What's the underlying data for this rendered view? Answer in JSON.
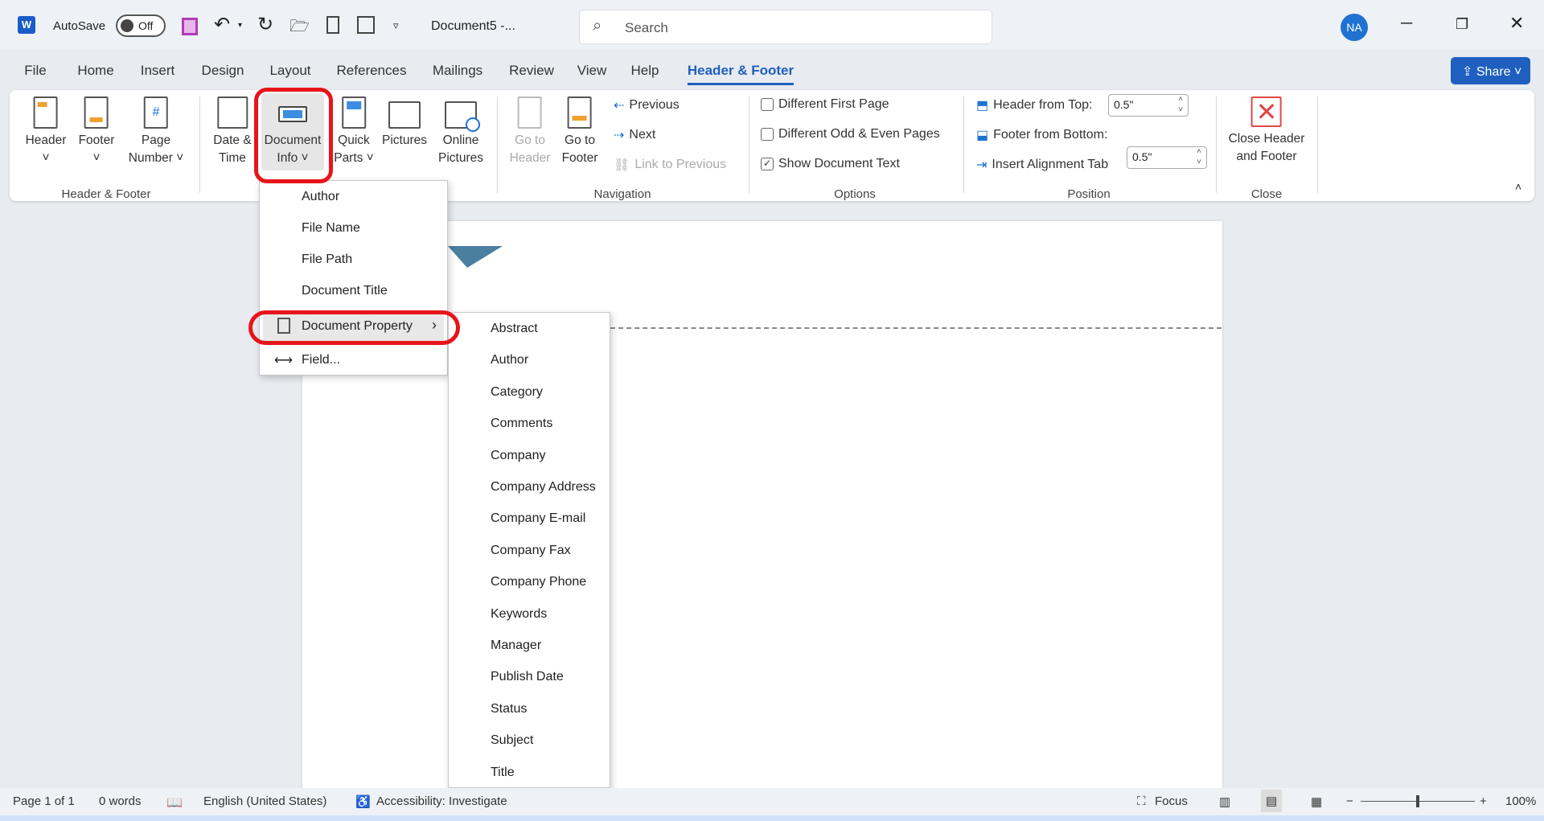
{
  "titlebar": {
    "autosave_label": "AutoSave",
    "autosave_state": "Off",
    "document_title": "Document5 -...",
    "search_placeholder": "Search",
    "avatar_initials": "NA",
    "accent_color": "#1f5fbf"
  },
  "tabs": [
    "File",
    "Home",
    "Insert",
    "Design",
    "Layout",
    "References",
    "Mailings",
    "Review",
    "View",
    "Help",
    "Header & Footer"
  ],
  "active_tab": "Header & Footer",
  "share_label": "Share",
  "ribbon": {
    "groups": {
      "header_footer": {
        "label": "Header & Footer",
        "header": "Header",
        "footer": "Footer",
        "page_number_1": "Page",
        "page_number_2": "Number"
      },
      "insert": {
        "date_1": "Date &",
        "date_2": "Time",
        "docinfo_1": "Document",
        "docinfo_2": "Info",
        "quick_1": "Quick",
        "quick_2": "Parts",
        "pictures": "Pictures",
        "online_1": "Online",
        "online_2": "Pictures"
      },
      "navigation": {
        "label": "Navigation",
        "goto_header_1": "Go to",
        "goto_header_2": "Header",
        "goto_footer_1": "Go to",
        "goto_footer_2": "Footer",
        "previous": "Previous",
        "next": "Next",
        "link_previous": "Link to Previous"
      },
      "options": {
        "label": "Options",
        "different_first": "Different First Page",
        "different_odd_even": "Different Odd & Even Pages",
        "show_text": "Show Document Text",
        "different_first_checked": false,
        "different_odd_even_checked": false,
        "show_text_checked": true
      },
      "position": {
        "label": "Position",
        "header_from_top": "Header from Top:",
        "header_value": "0.5\"",
        "footer_from_bottom": "Footer from Bottom:",
        "footer_value": "0.5\"",
        "insert_alignment_tab": "Insert Alignment Tab"
      },
      "close": {
        "label": "Close",
        "close_1": "Close Header",
        "close_2": "and Footer"
      }
    }
  },
  "document_info_menu": [
    "Author",
    "File Name",
    "File Path",
    "Document Title",
    "Document Property",
    "Field..."
  ],
  "document_property_submenu": [
    "Abstract",
    "Author",
    "Category",
    "Comments",
    "Company",
    "Company Address",
    "Company E-mail",
    "Company Fax",
    "Company Phone",
    "Keywords",
    "Manager",
    "Publish Date",
    "Status",
    "Subject",
    "Title"
  ],
  "statusbar": {
    "page": "Page 1 of 1",
    "words": "0 words",
    "language": "English (United States)",
    "accessibility": "Accessibility: Investigate",
    "focus": "Focus",
    "zoom": "100%"
  },
  "highlight_color": "#e8141b"
}
